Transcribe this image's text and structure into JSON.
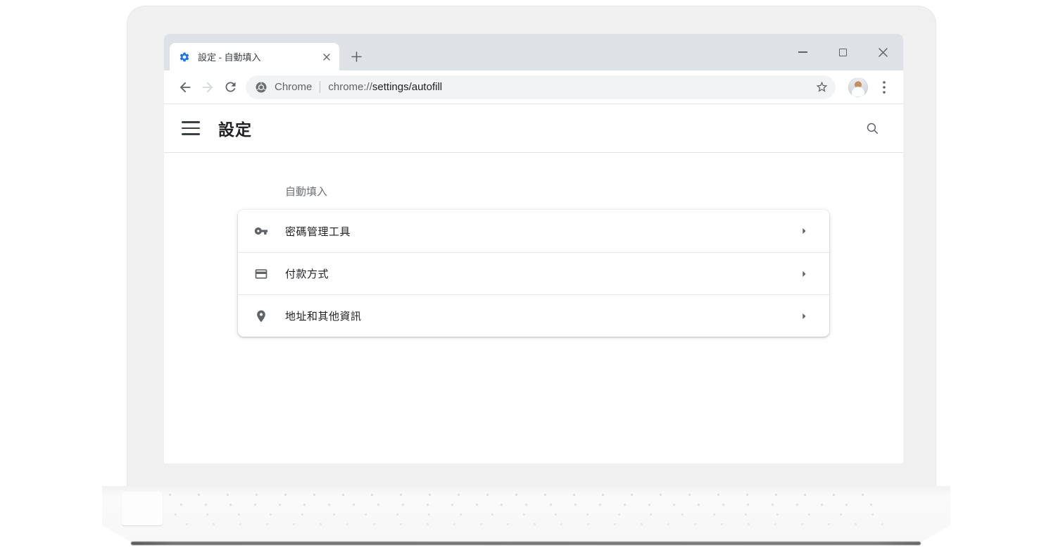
{
  "window": {
    "controls": [
      "minimize",
      "maximize",
      "close"
    ]
  },
  "browser": {
    "tab": {
      "title": "設定 - 自動填入",
      "favicon": "gear-icon"
    },
    "nav": {
      "site_label": "Chrome",
      "url_scheme": "chrome://",
      "url_path": "settings/autofill"
    }
  },
  "settings": {
    "title": "設定",
    "section_label": "自動填入",
    "items": [
      {
        "icon": "key-icon",
        "label": "密碼管理工具"
      },
      {
        "icon": "credit-card-icon",
        "label": "付款方式"
      },
      {
        "icon": "location-pin-icon",
        "label": "地址和其他資訊"
      }
    ]
  },
  "icons": [
    "gear-icon",
    "close-icon",
    "add-tab-icon",
    "minimize-icon",
    "maximize-icon",
    "back-icon",
    "forward-icon",
    "reload-icon",
    "chrome-logo-icon",
    "star-icon",
    "kebab-menu-icon",
    "hamburger-menu-icon",
    "search-icon",
    "key-icon",
    "credit-card-icon",
    "location-pin-icon",
    "arrow-right-icon"
  ],
  "colors": {
    "accent_blue": "#1a73e8",
    "icon_gray": "#5f6368",
    "text_primary": "#202124",
    "tab_strip_bg": "#dee1e6",
    "omnibox_bg": "#f1f3f4"
  }
}
